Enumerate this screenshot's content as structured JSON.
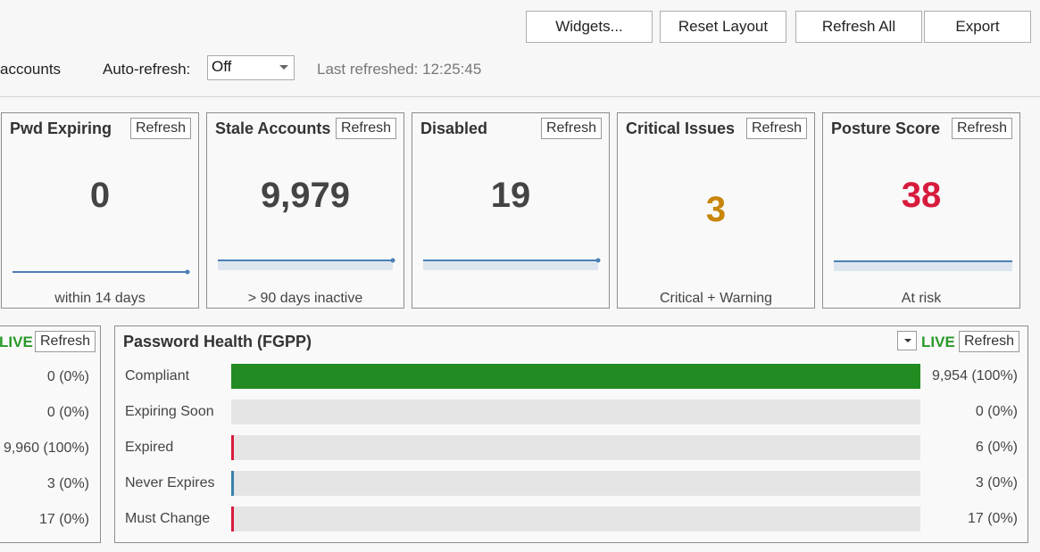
{
  "toolbar": {
    "widgets": "Widgets...",
    "reset_layout": "Reset Layout",
    "refresh_all": "Refresh All",
    "export": "Export",
    "accounts_label": "accounts",
    "auto_refresh_label": "Auto-refresh:",
    "auto_refresh_value": "Off",
    "last_refreshed": "Last refreshed: 12:25:45"
  },
  "cards": [
    {
      "title": "Pwd Expiring",
      "refresh": "Refresh",
      "value": "0",
      "sub": "within 14 days",
      "value_color": "#444444"
    },
    {
      "title": "Stale Accounts",
      "refresh": "Refresh",
      "value": "9,979",
      "sub": "> 90 days inactive",
      "value_color": "#444444"
    },
    {
      "title": "Disabled",
      "refresh": "Refresh",
      "value": "19",
      "sub": "",
      "value_color": "#444444"
    },
    {
      "title": "Critical Issues",
      "refresh": "Refresh",
      "value": "3",
      "sub": "Critical + Warning",
      "value_color": "#c8860a"
    },
    {
      "title": "Posture Score",
      "refresh": "Refresh",
      "value": "38",
      "sub": "At risk",
      "value_color": "#d81b3c"
    }
  ],
  "left_panel": {
    "live": "LIVE",
    "refresh": "Refresh",
    "values": [
      "0 (0%)",
      "0 (0%)",
      "9,960 (100%)",
      "3 (0%)",
      "17 (0%)"
    ]
  },
  "password_health": {
    "title": "Password Health (FGPP)",
    "live": "LIVE",
    "refresh": "Refresh",
    "rows": [
      {
        "label": "Compliant",
        "value": "9,954 (100%)",
        "fraction": 1.0,
        "color": "#228b22"
      },
      {
        "label": "Expiring Soon",
        "value": "0 (0%)",
        "fraction": 0.0,
        "color": "#228b22"
      },
      {
        "label": "Expired",
        "value": "6 (0%)",
        "fraction": 0.004,
        "color": "#d81b3c"
      },
      {
        "label": "Never Expires",
        "value": "3 (0%)",
        "fraction": 0.004,
        "color": "#3a7fb0"
      },
      {
        "label": "Must Change",
        "value": "17 (0%)",
        "fraction": 0.004,
        "color": "#d81b3c"
      }
    ]
  },
  "colors": {
    "live": "#2a9a2a",
    "sparkline": "#4a80b4"
  }
}
